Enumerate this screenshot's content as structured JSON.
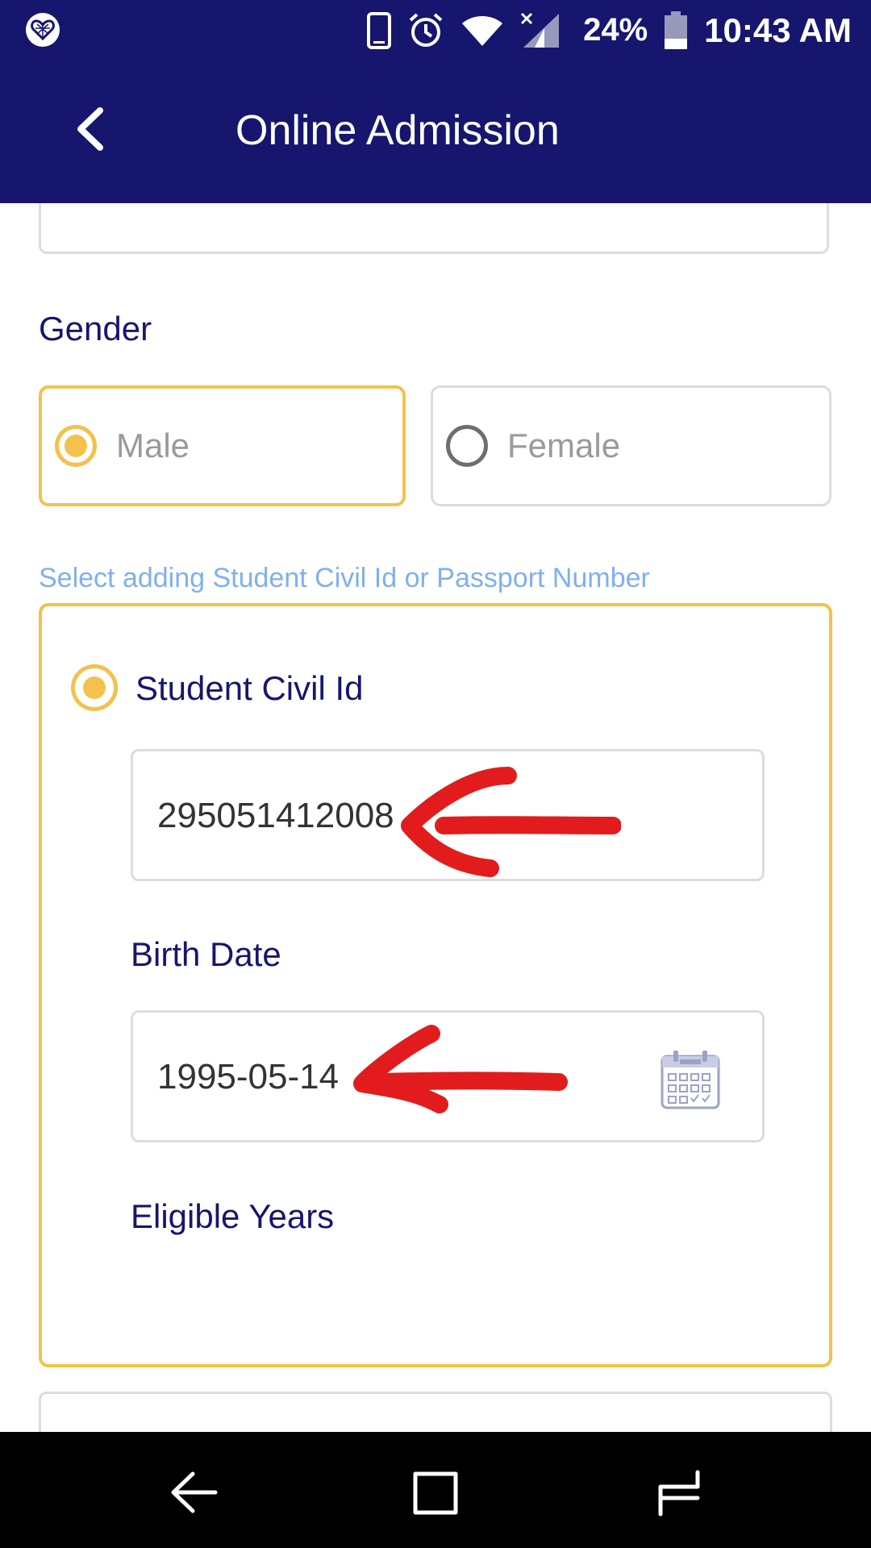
{
  "status_bar": {
    "battery": "24%",
    "time": "10:43 AM",
    "icons": [
      "app-heart-icon",
      "phone-icon",
      "alarm-icon",
      "wifi-icon",
      "signal-icon",
      "battery-icon"
    ]
  },
  "app_bar": {
    "title": "Online Admission",
    "back_icon": "chevron-left-icon"
  },
  "form": {
    "gender": {
      "label": "Gender",
      "options": [
        {
          "label": "Male",
          "selected": true
        },
        {
          "label": "Female",
          "selected": false
        }
      ]
    },
    "id_choice_hint": "Select adding Student Civil Id or Passport Number",
    "civil_id": {
      "label": "Student Civil Id",
      "selected": true,
      "value": "295051412008"
    },
    "birth_date": {
      "label": "Birth Date",
      "value": "1995-05-14",
      "icon": "calendar-icon"
    },
    "eligible_years": {
      "label": "Eligible Years"
    }
  },
  "annotations": {
    "arrow_color": "#e21c1c"
  },
  "colors": {
    "primary": "#16166e",
    "accent": "#f2c24c",
    "hint": "#7fb0f0",
    "border": "#dcdcdc"
  },
  "nav_bar": {
    "icons": [
      "back-nav-icon",
      "recents-icon",
      "home-icon"
    ]
  }
}
